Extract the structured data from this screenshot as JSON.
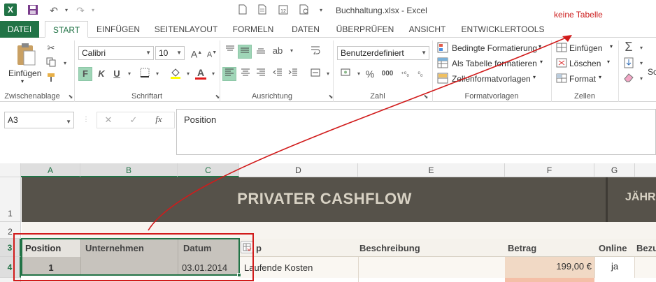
{
  "app": {
    "window_title": "Buchhaltung.xlsx - Excel",
    "annotation_note": "keine Tabelle"
  },
  "tabs": [
    "DATEI",
    "START",
    "EINFÜGEN",
    "SEITENLAYOUT",
    "FORMELN",
    "DATEN",
    "ÜBERPRÜFEN",
    "ANSICHT",
    "ENTWICKLERTOOLS"
  ],
  "ribbon": {
    "paste_label": "Einfügen",
    "font_name": "Calibri",
    "font_size": "10",
    "bold": "F",
    "italic": "K",
    "underline": "U",
    "number_format": "Benutzerdefiniert",
    "cond_format": "Bedingte Formatierung",
    "as_table": "Als Tabelle formatieren",
    "cell_styles": "Zellenformatvorlagen",
    "insert": "Einfügen",
    "delete": "Löschen",
    "format": "Format",
    "percent": "%",
    "thousands": "000",
    "cut_overflow": "Sc",
    "groups": {
      "clipboard": "Zwischenablage",
      "font": "Schriftart",
      "alignment": "Ausrichtung",
      "number": "Zahl",
      "styles": "Formatvorlagen",
      "cells": "Zellen"
    }
  },
  "formula_bar": {
    "name_box": "A3",
    "fx": "fx",
    "content": "Position"
  },
  "columns": [
    "A",
    "B",
    "C",
    "D",
    "E",
    "F",
    "G"
  ],
  "rows": [
    "1",
    "2",
    "3",
    "4"
  ],
  "sheet": {
    "title": "PRIVATER CASHFLOW",
    "title_right": "JÄHRL",
    "headers": {
      "a": "Position",
      "b": "Unternehmen",
      "c": "Datum",
      "d_suffix": "p",
      "e": "Beschreibung",
      "f": "Betrag",
      "g": "Online",
      "h": "Bezu"
    },
    "row4": {
      "position": "1",
      "datum": "03.01.2014",
      "typ": "Laufende Kosten",
      "betrag": "199,00 €",
      "online": "ja"
    }
  },
  "colors": {
    "accent": "#217346",
    "title_band": "#56524a",
    "title_text": "#d8d2c4",
    "header_band": "#f5f2ec",
    "selection_fill": "#c7c3bd",
    "annotation_red": "#d11b1b"
  }
}
